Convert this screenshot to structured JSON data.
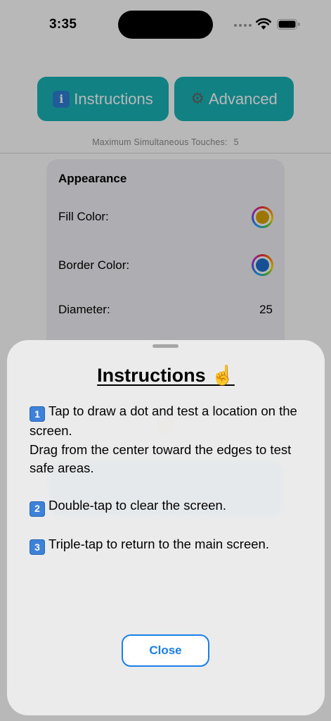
{
  "status_bar": {
    "time": "3:35"
  },
  "toolbar": {
    "instructions_label": "Instructions",
    "instructions_icon": "info-keycap-icon",
    "advanced_label": "Advanced",
    "advanced_icon": "gear-icon",
    "accent_color": "#18b3b8"
  },
  "touches": {
    "label": "Maximum Simultaneous Touches:",
    "value": "5"
  },
  "appearance": {
    "title": "Appearance",
    "fill_color_label": "Fill Color:",
    "fill_color_value": "#d9a400",
    "border_color_label": "Border Color:",
    "border_color_value": "#1e6fd1",
    "diameter_label": "Diameter:",
    "diameter_value": "25"
  },
  "sheet": {
    "title": "Instructions ☝️",
    "steps": [
      {
        "number": "1",
        "lines": [
          "Tap to draw a dot and test a location on the screen.",
          "Drag from the center toward the edges to test safe areas."
        ]
      },
      {
        "number": "2",
        "lines": [
          "Double-tap to clear the screen."
        ]
      },
      {
        "number": "3",
        "lines": [
          "Triple-tap to return to the main screen."
        ]
      }
    ],
    "close_label": "Close"
  }
}
